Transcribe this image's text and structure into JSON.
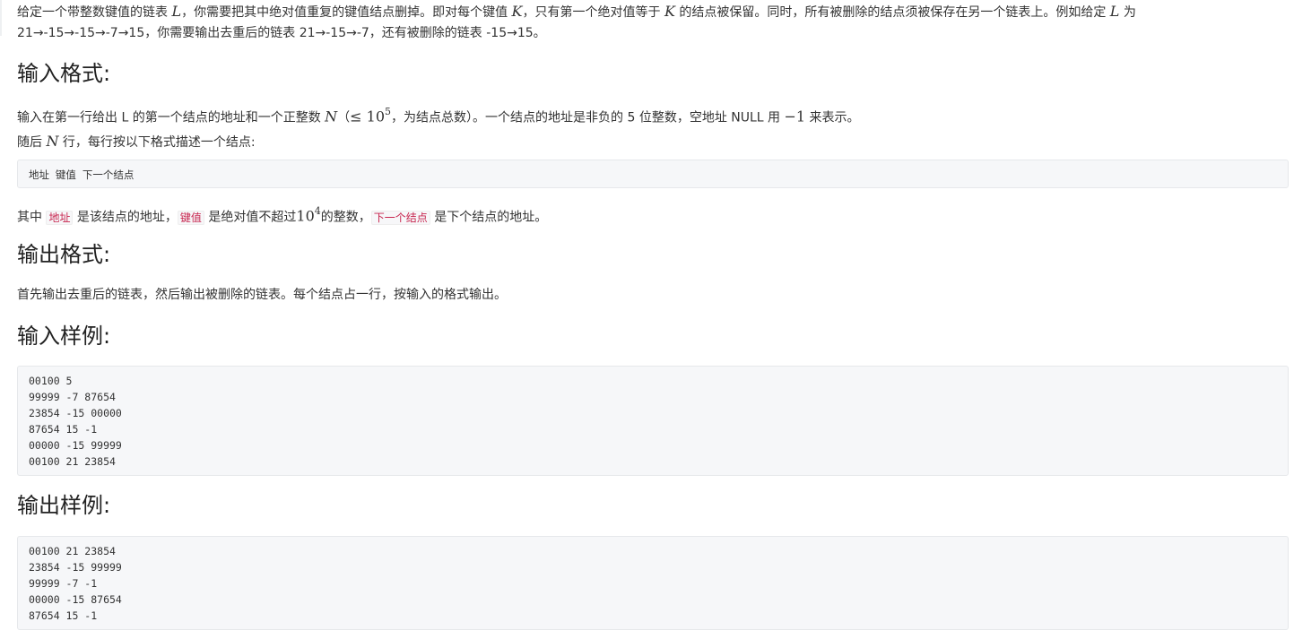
{
  "intro": {
    "t1": "给定一个带整数键值的链表 ",
    "m1": "L",
    "t2": "，你需要把其中绝对值重复的键值结点删掉。即对每个键值 ",
    "m2": "K",
    "t3": "，只有第一个绝对值等于 ",
    "m3": "K",
    "t4": " 的结点被保留。同时，所有被删除的结点须被保存在另一个链表上。例如给定 ",
    "m4": "L",
    "t5": " 为",
    "line2": "21→-15→-15→-7→15，你需要输出去重后的链表 21→-15→-7，还有被删除的链表 -15→15。"
  },
  "input_format": {
    "heading": "输入格式:",
    "p1_t1": "输入在第一行给出 L 的第一个结点的地址和一个正整数 ",
    "p1_m1": "N",
    "p1_t2": "（",
    "p1_m2": "≤ 10",
    "p1_sup": "5",
    "p1_t3": "，为结点总数）。一个结点的地址是非负的 5 位整数，空地址 NULL 用 ",
    "p1_m3": "−1",
    "p1_t4": " 来表示。",
    "p2_t1": "随后 ",
    "p2_m1": "N",
    "p2_t2": " 行，每行按以下格式描述一个结点:",
    "code": "地址 键值 下一个结点",
    "p3_t1": "其中 ",
    "p3_c1": "地址",
    "p3_t2": " 是该结点的地址，",
    "p3_c2": "键值",
    "p3_t3": " 是绝对值不超过",
    "p3_m1": "10",
    "p3_sup": "4",
    "p3_t4": "的整数，",
    "p3_c3": "下一个结点",
    "p3_t5": " 是下个结点的地址。"
  },
  "output_format": {
    "heading": "输出格式:",
    "p1": "首先输出去重后的链表，然后输出被删除的链表。每个结点占一行，按输入的格式输出。"
  },
  "sample_input": {
    "heading": "输入样例:",
    "lines": [
      "00100 5",
      "99999 -7 87654",
      "23854 -15 00000",
      "87654 15 -1",
      "00000 -15 99999",
      "00100 21 23854"
    ]
  },
  "sample_output": {
    "heading": "输出样例:",
    "lines": [
      "00100 21 23854",
      "23854 -15 99999",
      "99999 -7 -1",
      "00000 -15 87654",
      "87654 15 -1"
    ]
  }
}
